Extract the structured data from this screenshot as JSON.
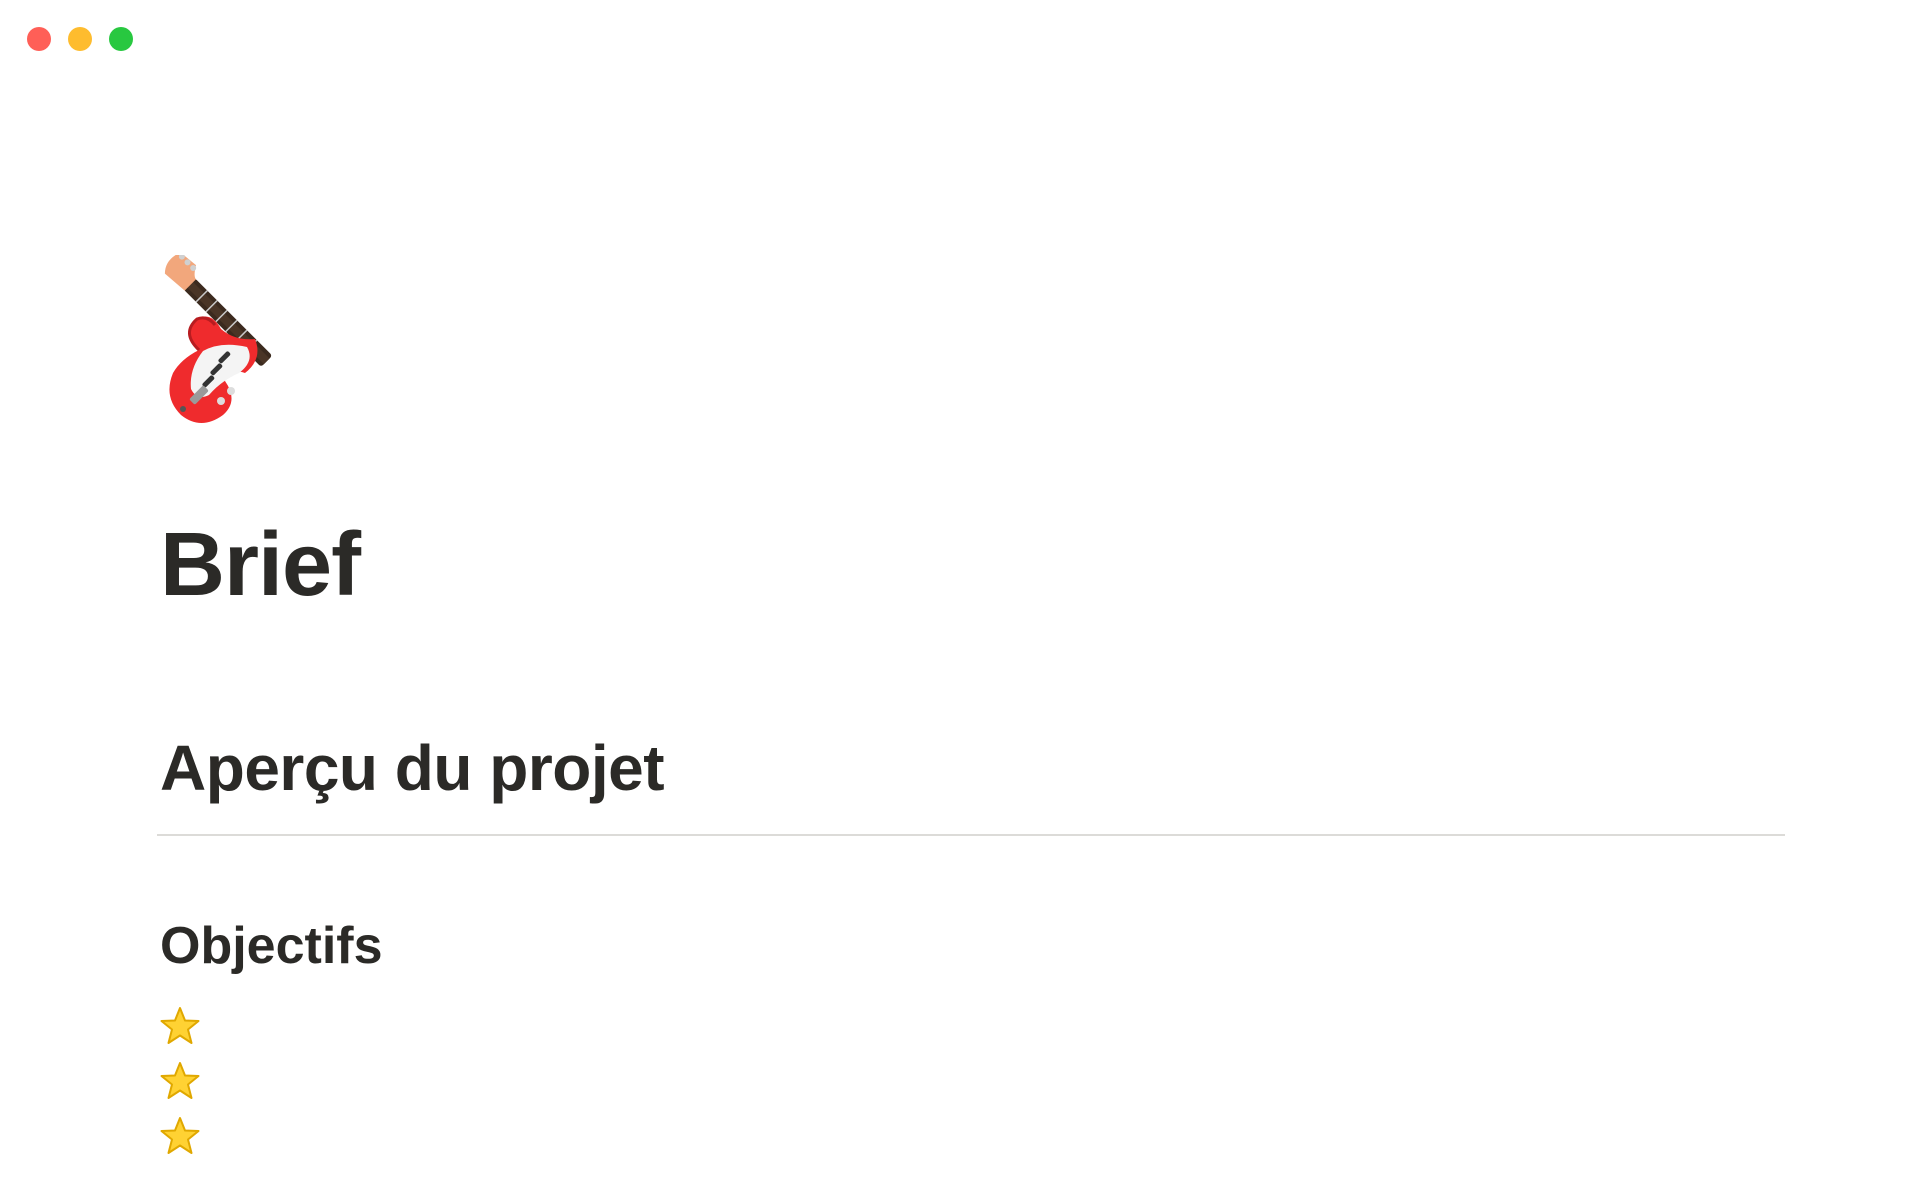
{
  "window": {
    "controls": [
      "close",
      "minimize",
      "zoom"
    ]
  },
  "page": {
    "icon": "electric-guitar-icon",
    "title": "Brief",
    "section_heading": "Aperçu du projet",
    "subsection_heading": "Objectifs",
    "objectives": [
      {
        "icon": "star-icon",
        "text": ""
      },
      {
        "icon": "star-icon",
        "text": ""
      },
      {
        "icon": "star-icon",
        "text": ""
      }
    ]
  },
  "colors": {
    "close": "#ff5f57",
    "minimize": "#febc2e",
    "zoom": "#28c840",
    "text": "#2b2a27",
    "divider": "#dcdbd8"
  }
}
